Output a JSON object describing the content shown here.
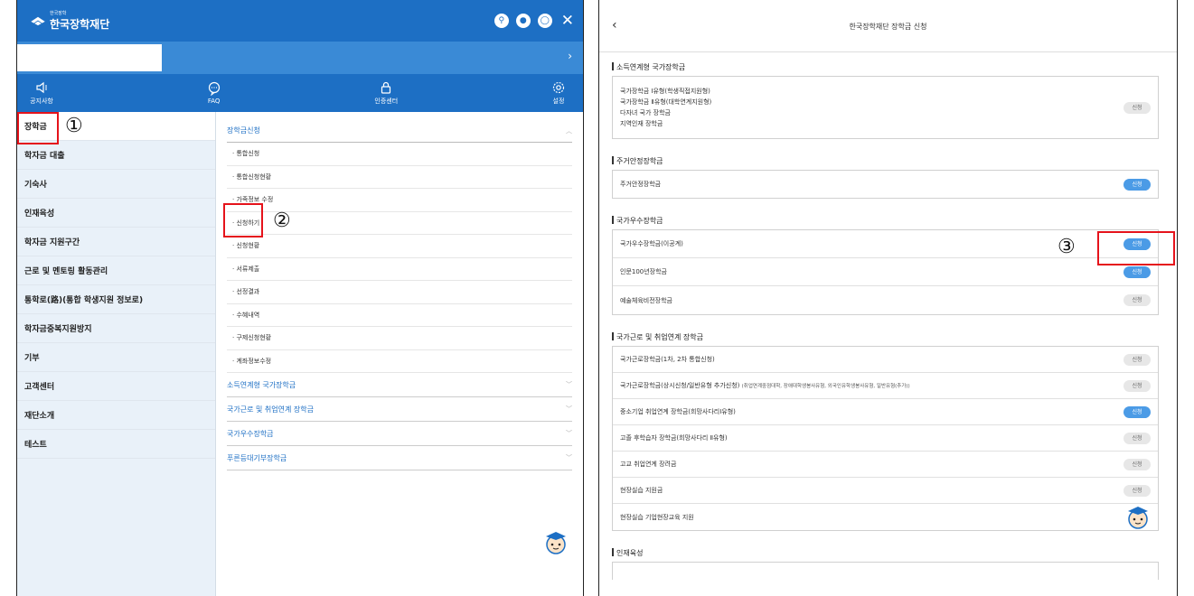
{
  "left_panel": {
    "org_name": "한국장학재단",
    "org_small": "한국장학",
    "top_icon_names": [
      "search-icon",
      "bell-icon",
      "user-icon",
      "close-icon"
    ],
    "quick_menu": [
      {
        "label": "공지사항",
        "icon": "speaker-icon"
      },
      {
        "label": "FAQ",
        "icon": "chat-icon"
      },
      {
        "label": "인증센터",
        "icon": "lock-icon"
      },
      {
        "label": "설정",
        "icon": "gear-icon"
      }
    ],
    "nav": [
      "장학금",
      "학자금 대출",
      "기숙사",
      "인재육성",
      "학자금 지원구간",
      "근로 및 멘토링 활동관리",
      "통학로(路)(통합 학생지원 정보로)",
      "학자금중복지원방지",
      "기부",
      "고객센터",
      "재단소개",
      "테스트"
    ],
    "sub_header": "장학금신청",
    "sub_items": [
      "· 통합신청",
      "· 통합신청현황",
      "· 가족정보 수정",
      "· 신청하기",
      "· 신청현황",
      "· 서류제출",
      "· 선정결과",
      "· 수혜내역",
      "· 구제신청현황",
      "· 계좌정보수정"
    ],
    "sub_groups": [
      "소득연계형 국가장학금",
      "국가근로 및 취업연계 장학금",
      "국가우수장학금",
      "푸른등대기부장학금"
    ]
  },
  "right_panel": {
    "title": "한국장학재단 장학금 신청",
    "sections": [
      {
        "title": "소득연계형 국가장학금",
        "multi_lines": [
          "국가장학금 Ⅰ유형(학생직접지원형)",
          "국가장학금 Ⅱ유형(대학연계지원형)",
          "다자녀 국가 장학금",
          "지역인재 장학금"
        ],
        "button": "신청"
      },
      {
        "title": "주거안정장학금",
        "rows": [
          {
            "label": "주거안정장학금",
            "button": "신청",
            "active": true
          }
        ]
      },
      {
        "title": "국가우수장학금",
        "rows": [
          {
            "label": "국가우수장학금(이공계)",
            "button": "신청",
            "active": true
          },
          {
            "label": "인문100년장학금",
            "button": "신청",
            "active": true
          },
          {
            "label": "예술체육비전장학금",
            "button": "신청",
            "active": false
          }
        ]
      },
      {
        "title": "국가근로 및 취업연계 장학금",
        "rows": [
          {
            "label": "국가근로장학금(1차, 2차 통합신청)",
            "button": "신청",
            "active": false
          },
          {
            "label": "국가근로장학금(상시신청/일반유형 추가신청)",
            "note": "(취업연계중점대학, 장애대학생봉사유형, 외국인유학생봉사유형, 일반유형(추가))",
            "button": "신청",
            "active": false
          },
          {
            "label": "중소기업 취업연계 장학금(희망사다리Ⅰ유형)",
            "button": "신청",
            "active": true
          },
          {
            "label": "고졸 후학습자 장학금(희망사다리 Ⅱ유형)",
            "button": "신청",
            "active": false
          },
          {
            "label": "고교 취업연계 장려금",
            "button": "신청",
            "active": false
          },
          {
            "label": "현장실습 지원금",
            "button": "신청",
            "active": false
          },
          {
            "label": "현장실습 기업현장교육 지원",
            "button": "",
            "active": false
          }
        ]
      },
      {
        "title": "인재육성",
        "rows": []
      }
    ]
  },
  "annotations": [
    "①",
    "②",
    "③"
  ],
  "colors": {
    "primary": "#1d6fc4",
    "secondary": "#3a8ad6",
    "nav_bg": "#e9f1f9",
    "highlight": "#e5131b",
    "button_on": "#4b9be6"
  }
}
